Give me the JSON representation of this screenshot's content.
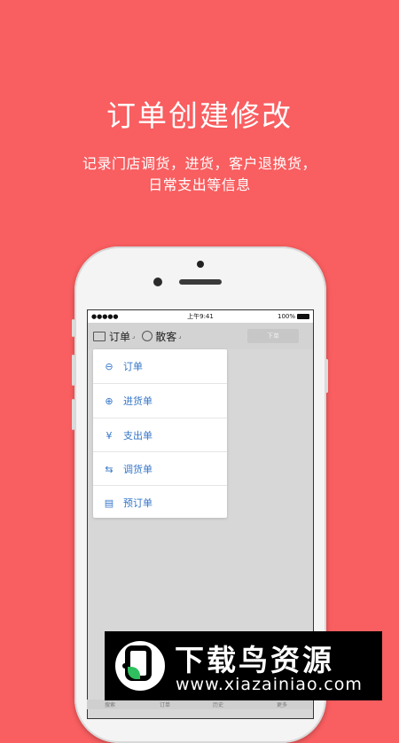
{
  "hero": {
    "title": "订单创建修改",
    "subtitle_line1": "记录门店调货，进货，客户退换货，",
    "subtitle_line2": "日常支出等信息"
  },
  "status_bar": {
    "carrier": "●●●●● ",
    "time": "上午9:41",
    "battery": "100%"
  },
  "nav": {
    "title": "订单",
    "customer": "散客",
    "action_button": "下单"
  },
  "menu": {
    "items": [
      {
        "label": "订单",
        "icon": "order-icon"
      },
      {
        "label": "进货单",
        "icon": "stock-in-icon"
      },
      {
        "label": "支出单",
        "icon": "yen-icon"
      },
      {
        "label": "调货单",
        "icon": "transfer-icon"
      },
      {
        "label": "预订单",
        "icon": "document-icon"
      }
    ]
  },
  "tabbar": {
    "items": [
      "搜索",
      "订单",
      "历史",
      "更多"
    ]
  },
  "watermark": {
    "brand": "下载鸟资源",
    "url": "www.xiazainiao.com"
  },
  "colors": {
    "background": "#F95E60",
    "menu_text": "#3476C8"
  }
}
